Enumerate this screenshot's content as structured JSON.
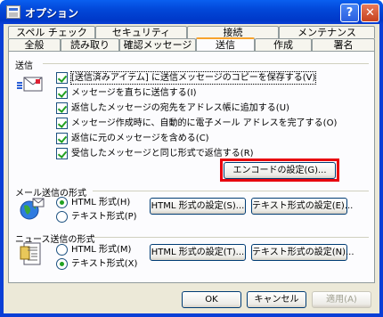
{
  "window": {
    "title": "オプション",
    "help_label": "?",
    "close_label": "✕"
  },
  "tabs_top": [
    "スペル チェック",
    "セキュリティ",
    "接続",
    "メンテナンス"
  ],
  "tabs_bottom": [
    "全般",
    "読み取り",
    "確認メッセージ",
    "送信",
    "作成",
    "署名"
  ],
  "active_tab": "送信",
  "send_section": {
    "label": "送信",
    "icon": "send-mail-icon",
    "options": [
      {
        "label": "[送信済みアイテム] に送信メッセージのコピーを保存する(V)",
        "checked": true
      },
      {
        "label": "メッセージを直ちに送信する(I)",
        "checked": true
      },
      {
        "label": "返信したメッセージの宛先をアドレス帳に追加する(U)",
        "checked": true
      },
      {
        "label": "メッセージ作成時に、自動的に電子メール アドレスを完了する(O)",
        "checked": true
      },
      {
        "label": "返信に元のメッセージを含める(C)",
        "checked": true
      },
      {
        "label": "受信したメッセージと同じ形式で返信する(R)",
        "checked": true
      }
    ],
    "encode_button": "エンコードの設定(G)..."
  },
  "mail_format": {
    "label": "メール送信の形式",
    "icon": "mail-globe-icon",
    "html_option": "HTML 形式(H)",
    "text_option": "テキスト形式(P)",
    "selected": "html",
    "html_settings_button": "HTML 形式の設定(S)...",
    "text_settings_button": "テキスト形式の設定(E)..."
  },
  "news_format": {
    "label": "ニュース送信の形式",
    "icon": "news-document-icon",
    "html_option": "HTML 形式(M)",
    "text_option": "テキスト形式(X)",
    "selected": "text",
    "html_settings_button": "HTML 形式の設定(T)...",
    "text_settings_button": "テキスト形式の設定(N)..."
  },
  "footer": {
    "ok": "OK",
    "cancel": "キャンセル",
    "apply": "適用(A)"
  },
  "colors": {
    "title_blue": "#0a3fd6",
    "dialog_bg": "#ece9d8",
    "highlight_red": "#e8000e"
  }
}
